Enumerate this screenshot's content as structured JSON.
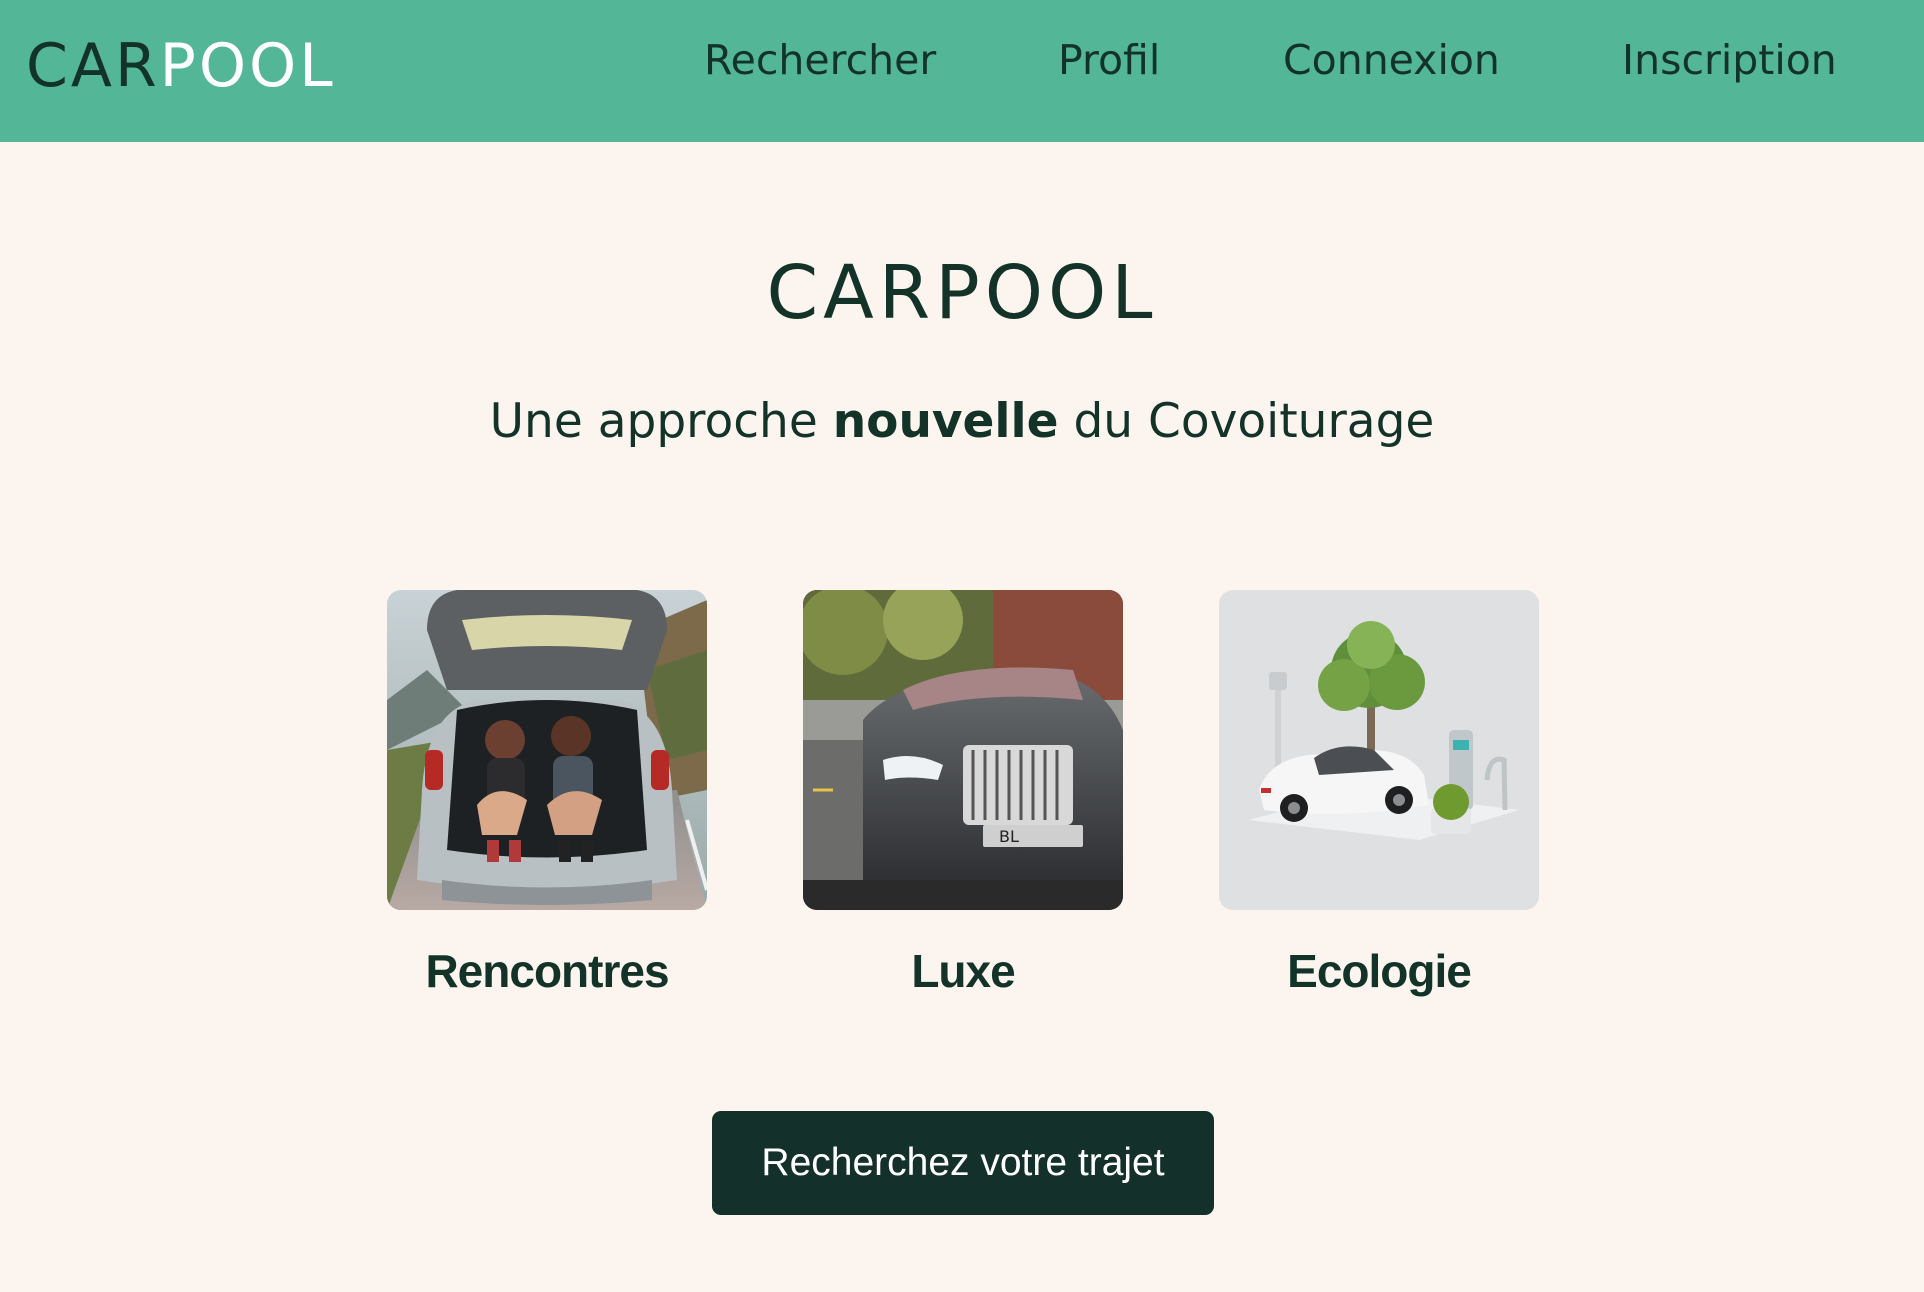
{
  "header": {
    "logo_part1": "CAR",
    "logo_part2": "POOL",
    "nav": {
      "search": "Rechercher",
      "profile": "Profil",
      "login": "Connexion",
      "signup": "Inscription"
    }
  },
  "hero": {
    "logo": "CARPOOL",
    "tagline_pre": "Une approche ",
    "tagline_bold": "nouvelle",
    "tagline_post": " du Covoiturage"
  },
  "cards": [
    {
      "label": "Rencontres"
    },
    {
      "label": "Luxe"
    },
    {
      "label": "Ecologie",
      "image_plate": "BL"
    }
  ],
  "cta": {
    "label": "Recherchez votre trajet"
  },
  "colors": {
    "header_bg": "#53b797",
    "page_bg": "#fcf4ef",
    "text_dark": "#133329",
    "button_bg": "#13302a"
  }
}
